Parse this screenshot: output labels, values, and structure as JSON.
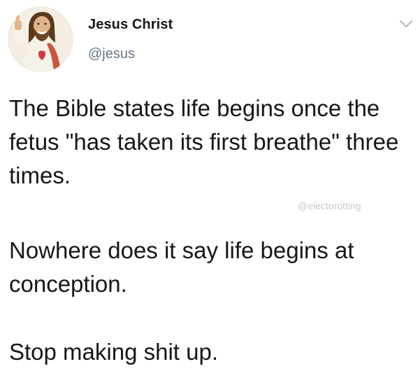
{
  "tweet": {
    "author": {
      "name": "Jesus Christ",
      "handle": "@jesus",
      "avatar_icon": "jesus-figure-avatar"
    },
    "menu_icon": "chevron-down-icon",
    "paragraphs": [
      "The Bible states life begins once the fetus \"has taken its first breathe\" three times.",
      "Nowhere does it say life begins at conception.",
      "Stop making shit up."
    ],
    "watermark": "@electorotting"
  },
  "colors": {
    "text": "#14171a",
    "secondary": "#657786",
    "watermark": "#c5c9cd"
  }
}
